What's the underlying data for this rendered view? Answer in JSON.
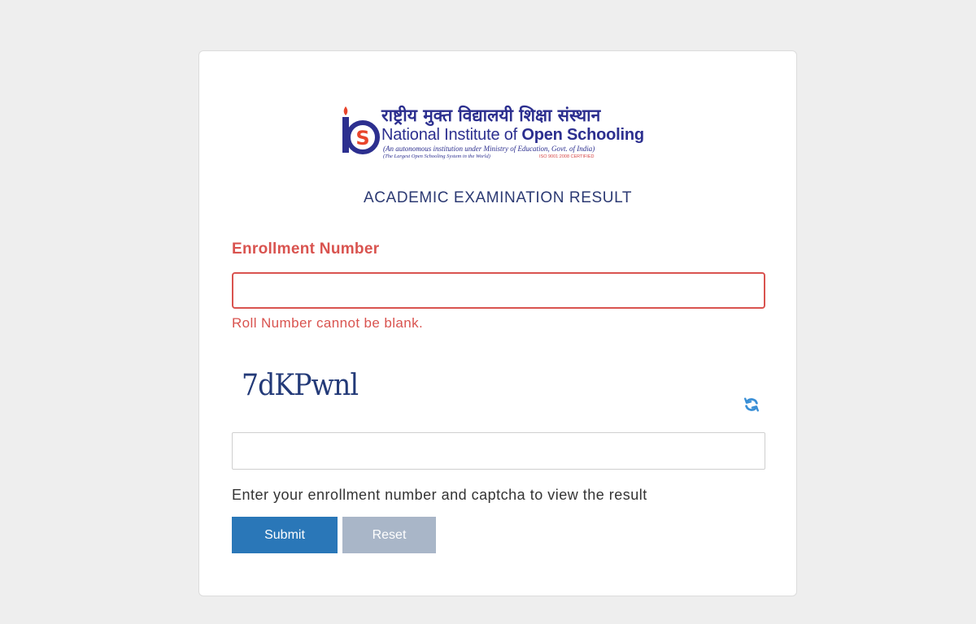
{
  "logo": {
    "hindi": "राष्ट्रीय मुक्त विद्यालयी शिक्षा संस्थान",
    "english_prefix": "National Institute of ",
    "english_bold": "Open Schooling",
    "sub1": "(An autonomous institution under Ministry of Education, Govt. of India)",
    "sub2": "(The Largest Open Schooling System in the World)",
    "iso": "ISO 9001:2008 CERTIFIED"
  },
  "page": {
    "title": "ACADEMIC EXAMINATION RESULT"
  },
  "form": {
    "enrollment_label": "Enrollment Number",
    "enrollment_value": "",
    "enrollment_error": "Roll Number cannot be blank.",
    "captcha_text": "7dKPwnl",
    "captcha_value": "",
    "help_text": "Enter your enrollment number and captcha to view the result",
    "submit_label": "Submit",
    "reset_label": "Reset"
  },
  "icons": {
    "refresh": "refresh-icon"
  },
  "colors": {
    "error": "#d9534f",
    "primary": "#2a77b8",
    "secondary": "#a9b6c8",
    "title": "#2c3a73",
    "captcha": "#233a78",
    "refresh": "#3a8fd6"
  }
}
